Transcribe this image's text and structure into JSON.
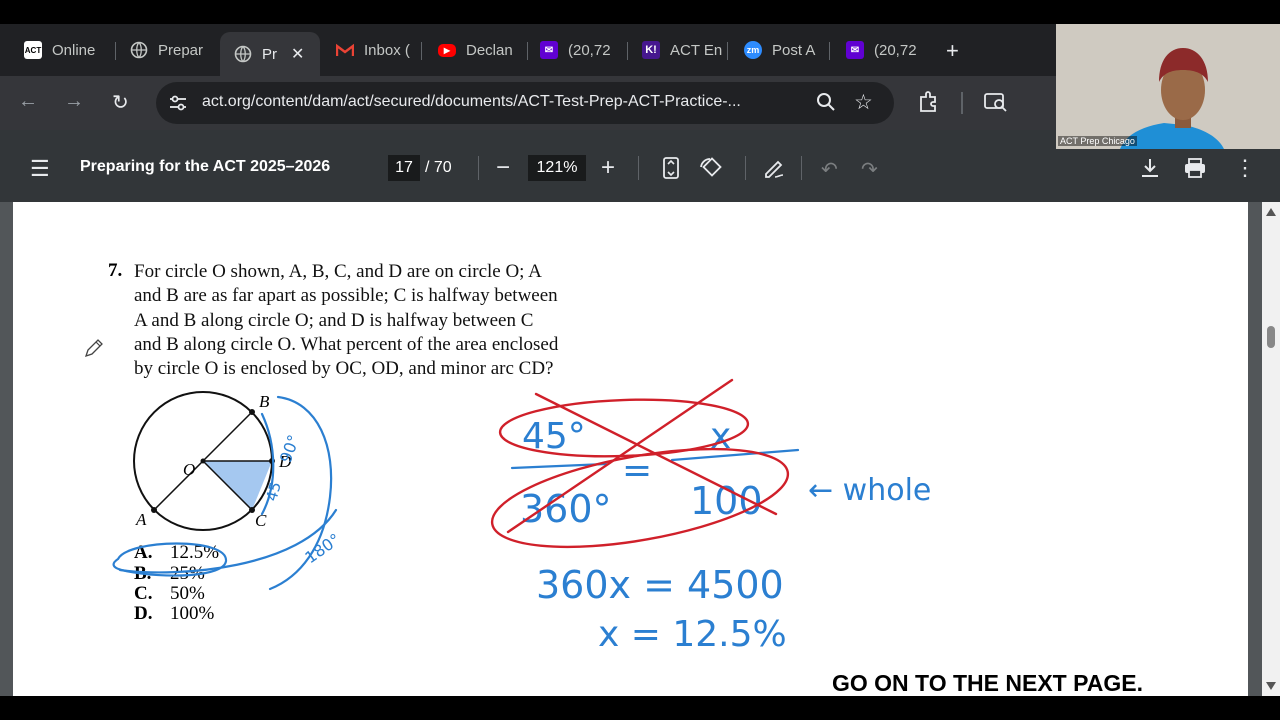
{
  "browser": {
    "tabs": [
      {
        "label": "Online",
        "icon": "act-logo-icon"
      },
      {
        "label": "Prepar",
        "icon": "globe-icon"
      },
      {
        "label": "Pr",
        "icon": "globe-icon",
        "active": true
      },
      {
        "label": "Inbox (",
        "icon": "gmail-icon"
      },
      {
        "label": "Declan",
        "icon": "youtube-icon"
      },
      {
        "label": "(20,72",
        "icon": "yahoo-mail-icon"
      },
      {
        "label": "ACT En",
        "icon": "kahoot-icon"
      },
      {
        "label": "Post A",
        "icon": "zoom-icon"
      },
      {
        "label": "(20,72",
        "icon": "yahoo-mail-icon"
      }
    ],
    "new_tab_label": "+",
    "url": "act.org/content/dam/act/secured/documents/ACT-Test-Prep-ACT-Practice-..."
  },
  "pdf_toolbar": {
    "title": "Preparing for the ACT 2025–2026",
    "current_page": "17",
    "page_count": "/ 70",
    "zoom": "121%"
  },
  "question": {
    "number": "7.",
    "lines": [
      "For circle O shown, A, B, C, and D are on circle O; A",
      "and B are as far apart as possible; C is halfway between",
      "A and B along circle O; and D is halfway between C",
      "and B along circle O. What percent of the area enclosed",
      "by circle O is enclosed by OC, OD, and minor arc CD?"
    ],
    "figure_labels": {
      "b": "B",
      "o": "O",
      "d": "D",
      "a": "A",
      "c": "C"
    },
    "choices": [
      {
        "letter": "A.",
        "text": "12.5%"
      },
      {
        "letter": "B.",
        "text": "25%"
      },
      {
        "letter": "C.",
        "text": "50%"
      },
      {
        "letter": "D.",
        "text": "100%"
      }
    ]
  },
  "annotations": {
    "top_left": "45°",
    "top_right": "x",
    "equals": "=",
    "bottom_left": "360°",
    "bottom_right": "100",
    "arrow_note": "← whole",
    "eq1": "360x = 4500",
    "eq2": "x = 12.5%",
    "arc_note_90": "90°",
    "arc_note_45": "45",
    "arc_note_180": "180°"
  },
  "footer": {
    "next_page": "GO ON TO THE NEXT PAGE."
  },
  "webcam": {
    "label": "ACT Prep Chicago"
  },
  "colors": {
    "ink_blue": "#2b7fd1",
    "ink_red": "#d0202a",
    "tab_bg": "#202124",
    "toolbar_bg": "#35363a",
    "pdf_bar": "#323639"
  }
}
